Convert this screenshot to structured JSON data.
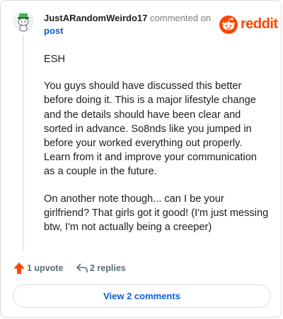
{
  "comment": {
    "author": "JustARandomWeirdo17",
    "action_text": "commented on",
    "target_link": "post",
    "paragraphs": [
      "ESH",
      "You guys should have discussed this better before doing it. This is a major lifestyle change and the details should have been clear and sorted in advance. So8nds like you jumped in before your worked everything out properly. Learn from it and improve your communication as a couple in the future.",
      "On another note though... can I be your girlfriend? That girls got it good! (I'm just messing btw, I'm not actually being a creeper)"
    ]
  },
  "brand": {
    "wordmark": "reddit",
    "color": "#ff4500"
  },
  "actions": {
    "upvote_label": "1 upvote",
    "replies_label": "2 replies",
    "upvote_icon": "upvote-arrow-icon",
    "reply_icon": "reply-arrow-icon",
    "upvote_color": "#ff4500"
  },
  "footer": {
    "view_comments_label": "View 2 comments"
  },
  "colors": {
    "link": "#0b5fd6",
    "muted": "#576f76",
    "border": "#dcdcdc"
  }
}
